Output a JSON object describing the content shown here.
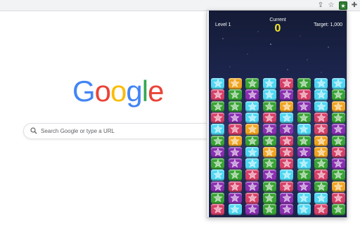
{
  "toolbar": {
    "icons": [
      "share-icon",
      "bookmark-star-icon",
      "extension-game-icon",
      "puzzle-extensions-icon"
    ]
  },
  "google": {
    "logo_letters": [
      "G",
      "o",
      "o",
      "g",
      "l",
      "e"
    ],
    "logo_colors": [
      "#4285f4",
      "#ea4335",
      "#fbbc05",
      "#4285f4",
      "#34a853",
      "#ea4335"
    ],
    "search_placeholder": "Search Google or type a URL"
  },
  "game": {
    "level_label": "Level 1",
    "current_label": "Current",
    "current_value": "0",
    "target_label": "Target: 1,000",
    "colors": {
      "C": "#4fd7f2",
      "G": "#3aa335",
      "P": "#8a2fb0",
      "R": "#d64068",
      "O": "#f0a420"
    },
    "board": [
      "COGCRGCC",
      "RGPCPRCG",
      "GGCGOPCO",
      "RPCRCGRG",
      "CROPPCRP",
      "GOGGRGOG",
      "PPCORPOR",
      "GPCGRCGP",
      "CGRPCGRG",
      "PRPGRPGO",
      "GPRGPCCR",
      "RCPGPCRG"
    ]
  }
}
